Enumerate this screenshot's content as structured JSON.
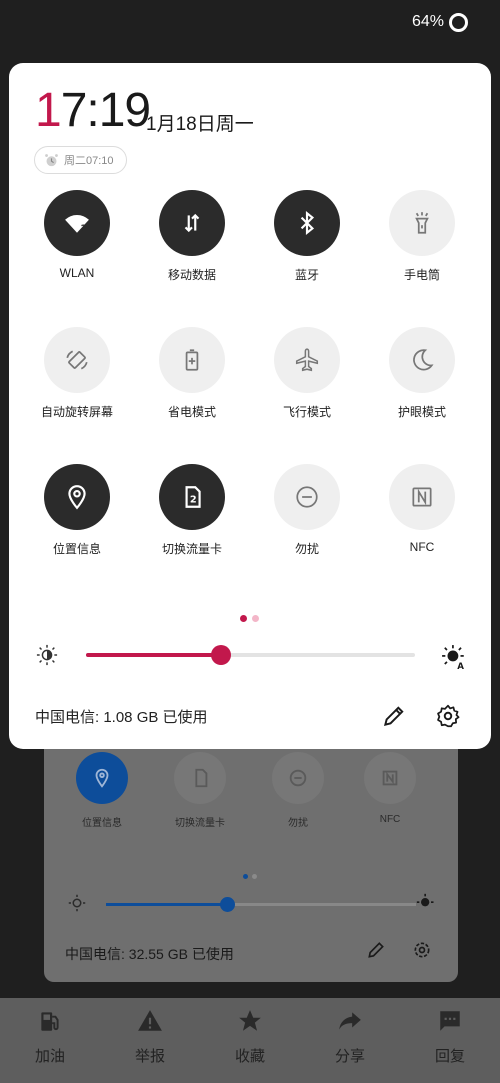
{
  "status_bar": {
    "battery": "64%"
  },
  "panel": {
    "clock_hour_first": "1",
    "clock_rest": "7:19",
    "date": "1月18日周一",
    "alarm": "周二07:10",
    "tiles": [
      {
        "label": "WLAN",
        "icon": "wifi-question-icon",
        "on": true
      },
      {
        "label": "移动数据",
        "icon": "mobile-data-icon",
        "on": true
      },
      {
        "label": "蓝牙",
        "icon": "bluetooth-icon",
        "on": true
      },
      {
        "label": "手电筒",
        "icon": "flashlight-icon",
        "on": false
      },
      {
        "label": "自动旋转屏幕",
        "icon": "auto-rotate-icon",
        "on": false
      },
      {
        "label": "省电模式",
        "icon": "battery-saver-icon",
        "on": false
      },
      {
        "label": "飞行模式",
        "icon": "airplane-icon",
        "on": false
      },
      {
        "label": "护眼模式",
        "icon": "moon-icon",
        "on": false
      },
      {
        "label": "位置信息",
        "icon": "location-icon",
        "on": true
      },
      {
        "label": "切换流量卡",
        "icon": "sim-card-icon",
        "on": true
      },
      {
        "label": "勿扰",
        "icon": "do-not-disturb-icon",
        "on": false
      },
      {
        "label": "NFC",
        "icon": "nfc-icon",
        "on": false
      }
    ],
    "page_indicator": {
      "current": 1,
      "total": 2
    },
    "brightness": 0.41,
    "data_usage": "中国电信: 1.08 GB 已使用",
    "accent_color": "#c2184c"
  },
  "background": {
    "tiles": [
      "位置信息",
      "切换流量卡",
      "勿扰",
      "NFC"
    ],
    "data_usage": "中国电信: 32.55 GB 已使用",
    "brightness": 0.39,
    "accent_color": "#0d4d9a"
  },
  "bottom_nav": [
    {
      "label": "加油",
      "icon": "fuel-icon"
    },
    {
      "label": "举报",
      "icon": "warning-icon"
    },
    {
      "label": "收藏",
      "icon": "star-icon"
    },
    {
      "label": "分享",
      "icon": "share-icon"
    },
    {
      "label": "回复",
      "icon": "comment-icon"
    }
  ]
}
